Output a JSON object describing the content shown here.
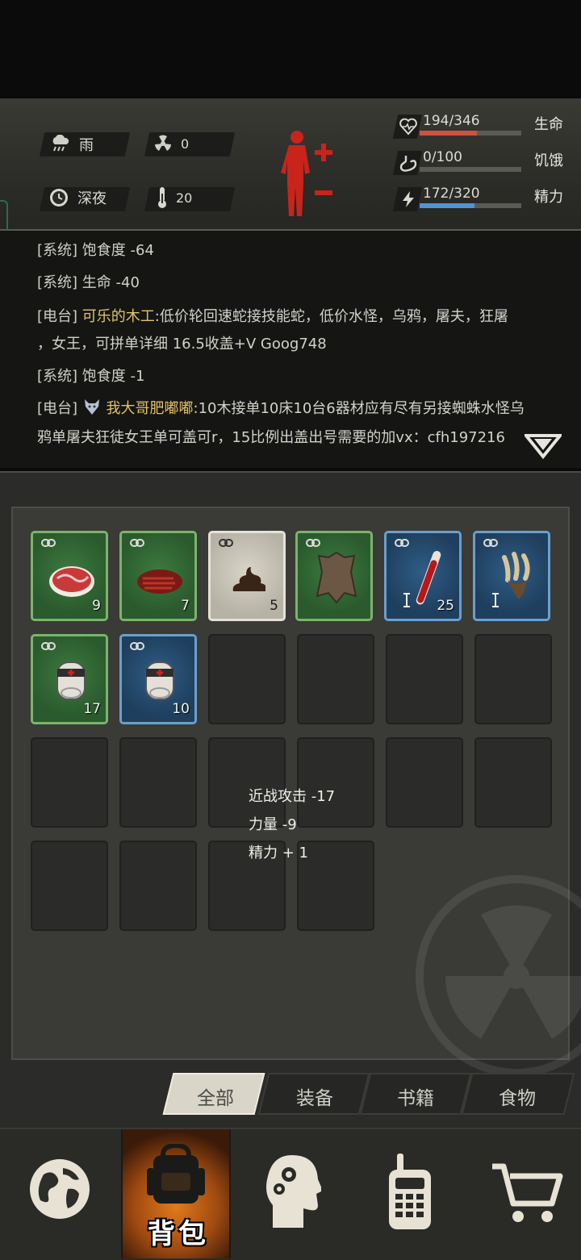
{
  "hud": {
    "weather": "雨",
    "radiation": "0",
    "time_of_day": "深夜",
    "temperature": "20",
    "stats": [
      {
        "name": "生命",
        "value": "194/346",
        "fraction": 0.56,
        "color": "#d0513f",
        "icon": "heart-pulse-icon"
      },
      {
        "name": "饥饿",
        "value": "0/100",
        "fraction": 0.0,
        "color": "#888880",
        "icon": "stomach-icon"
      },
      {
        "name": "精力",
        "value": "172/320",
        "fraction": 0.54,
        "color": "#4f93d6",
        "icon": "energy-bolt-icon"
      }
    ]
  },
  "log": {
    "lines": [
      {
        "tag": "[系统]",
        "text": "饱食度 -64"
      },
      {
        "tag": "[系统]",
        "text": "生命 -40"
      },
      {
        "tag": "[电台]",
        "name": "可乐的木工",
        "text": ":低价轮回速蛇接技能蛇，低价水怪，乌鸦，屠夫，狂屠"
      },
      {
        "tag": "",
        "text": "，女王，可拼单详细 16.5收盖+V Goog748"
      },
      {
        "tag": "[系统]",
        "text": "饱食度 -1"
      },
      {
        "tag": "[电台]",
        "name": "我大哥肥嘟嘟",
        "text": ":10木接单10床10台6器材应有尽有另接蜘蛛水怪乌"
      },
      {
        "tag": "",
        "text": "鸦单屠夫狂徒女王单可盖可r，15比例出盖出号需要的加vx：cfh197216"
      }
    ]
  },
  "inventory": {
    "items": [
      {
        "name": "raw-meat",
        "rarity": "green",
        "count": "9"
      },
      {
        "name": "cooked-steak",
        "rarity": "green",
        "count": "7"
      },
      {
        "name": "dung",
        "rarity": "grey",
        "count": "5"
      },
      {
        "name": "animal-hide",
        "rarity": "green",
        "count": ""
      },
      {
        "name": "blood-vial",
        "rarity": "blue",
        "count": "25"
      },
      {
        "name": "claws",
        "rarity": "blue",
        "count": ""
      },
      {
        "name": "bandage-green",
        "rarity": "green",
        "count": "17"
      },
      {
        "name": "bandage-blue",
        "rarity": "blue",
        "count": "10"
      }
    ],
    "tooltip": [
      "近战攻击 -17",
      "力量 -9",
      "精力 + 1"
    ]
  },
  "tabs": [
    "全部",
    "装备",
    "书籍",
    "食物"
  ],
  "nav": {
    "active_label": "背包"
  }
}
